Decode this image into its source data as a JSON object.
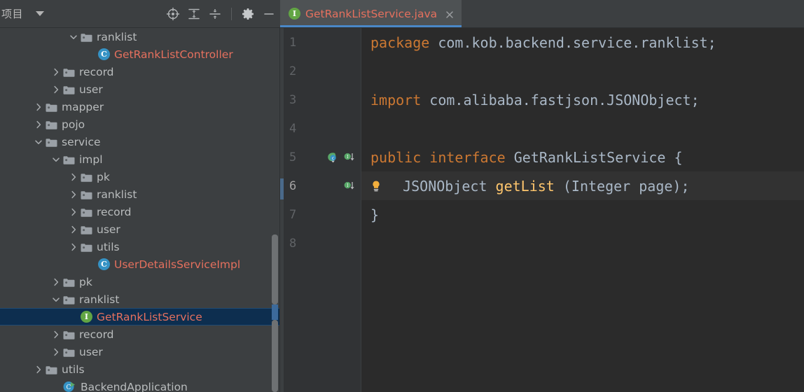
{
  "window": {
    "theme": "darcula",
    "colors": {
      "panel_bg": "#3c3f41",
      "editor_bg": "#2b2b2b",
      "gutter_bg": "#313335",
      "selection_bg": "#0d2e4f",
      "tab_active_bg": "#4e5254",
      "tab_underline": "#4a88c7",
      "keyword": "#cc7832",
      "identifier": "#a9b7c6",
      "method": "#ffc66d",
      "file_red": "#e5705e",
      "interface_badge": "#62a544",
      "class_badge": "#3592c4"
    }
  },
  "project_toolbar": {
    "title": "项目",
    "dropdown_icon": "chevron-down-icon",
    "buttons": [
      {
        "name": "locate-file-button",
        "icon": "crosshair-target-icon",
        "label": ""
      },
      {
        "name": "expand-all-button",
        "icon": "expand-all-icon",
        "label": ""
      },
      {
        "name": "collapse-all-button",
        "icon": "collapse-all-icon",
        "label": ""
      },
      {
        "name": "settings-button",
        "icon": "gear-icon",
        "label": ""
      },
      {
        "name": "hide-panel-button",
        "icon": "minimize-dash-icon",
        "label": ""
      }
    ]
  },
  "editor_tabs": [
    {
      "label": "GetRankListService.java",
      "icon": "interface-badge-icon",
      "icon_letter": "I",
      "close_icon": "close-icon",
      "active": true
    }
  ],
  "project_tree": {
    "rows": [
      {
        "label": "ranklist",
        "indent": 5,
        "arrow": "chevron-down",
        "icon": "folder",
        "color": "gray"
      },
      {
        "label": "GetRankListController",
        "indent": 6,
        "arrow": "none",
        "icon": "class",
        "color": "red",
        "icon_letter": "C"
      },
      {
        "label": "record",
        "indent": 4,
        "arrow": "chevron-right",
        "icon": "folder",
        "color": "gray"
      },
      {
        "label": "user",
        "indent": 4,
        "arrow": "chevron-right",
        "icon": "folder",
        "color": "gray"
      },
      {
        "label": "mapper",
        "indent": 3,
        "arrow": "chevron-right",
        "icon": "folder",
        "color": "gray"
      },
      {
        "label": "pojo",
        "indent": 3,
        "arrow": "chevron-right",
        "icon": "folder",
        "color": "gray"
      },
      {
        "label": "service",
        "indent": 3,
        "arrow": "chevron-down",
        "icon": "folder",
        "color": "gray"
      },
      {
        "label": "impl",
        "indent": 4,
        "arrow": "chevron-down",
        "icon": "folder",
        "color": "gray"
      },
      {
        "label": "pk",
        "indent": 5,
        "arrow": "chevron-right",
        "icon": "folder",
        "color": "gray"
      },
      {
        "label": "ranklist",
        "indent": 5,
        "arrow": "chevron-right",
        "icon": "folder",
        "color": "gray"
      },
      {
        "label": "record",
        "indent": 5,
        "arrow": "chevron-right",
        "icon": "folder",
        "color": "gray"
      },
      {
        "label": "user",
        "indent": 5,
        "arrow": "chevron-right",
        "icon": "folder",
        "color": "gray"
      },
      {
        "label": "utils",
        "indent": 5,
        "arrow": "chevron-right",
        "icon": "folder",
        "color": "gray"
      },
      {
        "label": "UserDetailsServiceImpl",
        "indent": 6,
        "arrow": "none",
        "icon": "class",
        "color": "red",
        "icon_letter": "C"
      },
      {
        "label": "pk",
        "indent": 4,
        "arrow": "chevron-right",
        "icon": "folder",
        "color": "gray"
      },
      {
        "label": "ranklist",
        "indent": 4,
        "arrow": "chevron-down",
        "icon": "folder",
        "color": "gray"
      },
      {
        "label": "GetRankListService",
        "indent": 5,
        "arrow": "none",
        "icon": "interface",
        "color": "red",
        "icon_letter": "I",
        "selected": true
      },
      {
        "label": "record",
        "indent": 4,
        "arrow": "chevron-right",
        "icon": "folder",
        "color": "gray"
      },
      {
        "label": "user",
        "indent": 4,
        "arrow": "chevron-right",
        "icon": "folder",
        "color": "gray"
      },
      {
        "label": "utils",
        "indent": 3,
        "arrow": "chevron-right",
        "icon": "folder",
        "color": "gray"
      },
      {
        "label": "BackendApplication",
        "indent": 4,
        "arrow": "none",
        "icon": "runnable-class",
        "color": "gray",
        "icon_letter": "C"
      }
    ]
  },
  "editor": {
    "file": "GetRankListService.java",
    "language": "java",
    "caret_line": 6,
    "lines": [
      {
        "number": "1",
        "gutter_icons": [],
        "tokens": [
          {
            "text": "package",
            "style": "kw"
          },
          {
            "text": " com.kob.backend.service.ranklist;",
            "style": "id"
          }
        ]
      },
      {
        "number": "2",
        "gutter_icons": [],
        "tokens": []
      },
      {
        "number": "3",
        "gutter_icons": [],
        "tokens": [
          {
            "text": "import",
            "style": "kw"
          },
          {
            "text": " com.alibaba.fastjson.JSONObject;",
            "style": "id"
          }
        ]
      },
      {
        "number": "4",
        "gutter_icons": [],
        "tokens": []
      },
      {
        "number": "5",
        "gutter_icons": [
          "spring-bean-icon",
          "implemented-by-icon"
        ],
        "tokens": [
          {
            "text": "public interface",
            "style": "kw"
          },
          {
            "text": " GetRankListService {",
            "style": "id"
          }
        ]
      },
      {
        "number": "6",
        "gutter_icons": [
          "implemented-by-icon"
        ],
        "inline_hint_icon": "lightbulb-icon",
        "tokens": [
          {
            "text": "  JSONObject ",
            "style": "id"
          },
          {
            "text": "getList",
            "style": "fn"
          },
          {
            "text": " (Integer page);",
            "style": "id"
          }
        ]
      },
      {
        "number": "7",
        "gutter_icons": [],
        "tokens": [
          {
            "text": "}",
            "style": "id"
          }
        ]
      },
      {
        "number": "8",
        "gutter_icons": [],
        "tokens": []
      }
    ]
  }
}
